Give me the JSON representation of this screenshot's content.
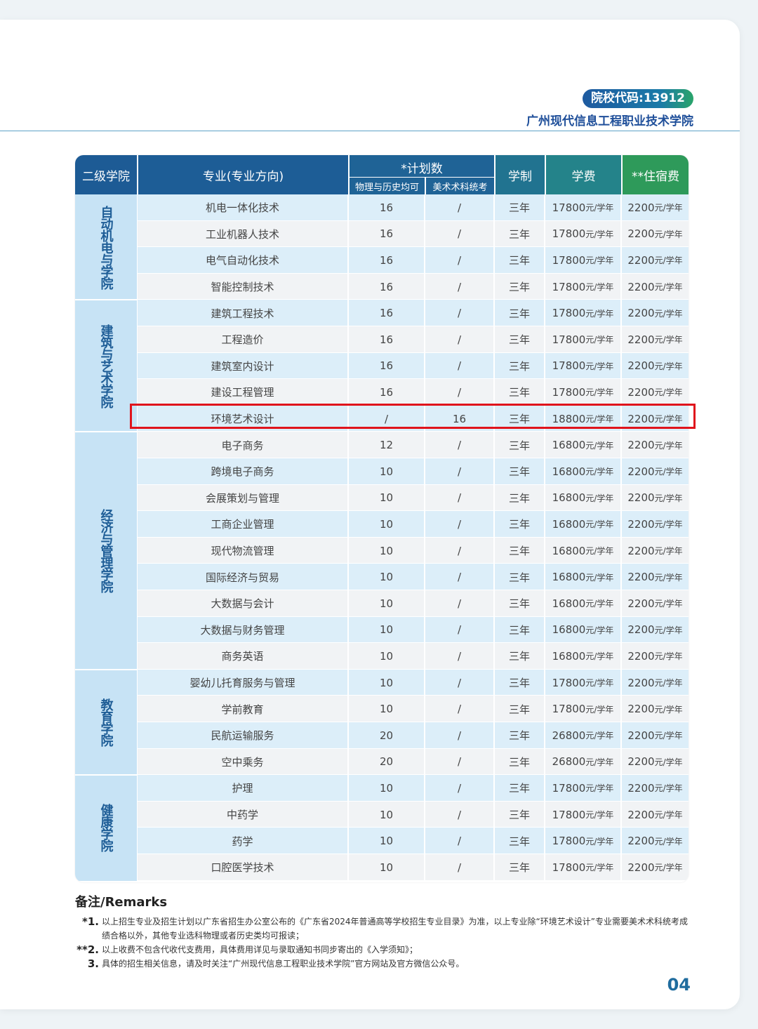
{
  "header": {
    "code": "院校代码:13912",
    "school": "广州现代信息工程职业技术学院"
  },
  "table": {
    "headers": {
      "college": "二级学院",
      "major": "专业(专业方向)",
      "plan": "*计划数",
      "plan_a": "物理与历史均可",
      "plan_b": "美术术科统考",
      "duration": "学制",
      "tuition": "学费",
      "dorm": "**住宿费"
    },
    "colleges": [
      {
        "name": "自动机电与学院",
        "rows": 4
      },
      {
        "name": "建筑与艺术学院",
        "rows": 5
      },
      {
        "name": "经济与管理学院",
        "rows": 9
      },
      {
        "name": "教育学院",
        "rows": 4
      },
      {
        "name": "健康学院",
        "rows": 4
      }
    ],
    "rows": [
      {
        "major": "机电一体化技术",
        "plan_a": "16",
        "plan_b": "/",
        "duration": "三年",
        "tuition": "17800",
        "dorm": "2200"
      },
      {
        "major": "工业机器人技术",
        "plan_a": "16",
        "plan_b": "/",
        "duration": "三年",
        "tuition": "17800",
        "dorm": "2200"
      },
      {
        "major": "电气自动化技术",
        "plan_a": "16",
        "plan_b": "/",
        "duration": "三年",
        "tuition": "17800",
        "dorm": "2200"
      },
      {
        "major": "智能控制技术",
        "plan_a": "16",
        "plan_b": "/",
        "duration": "三年",
        "tuition": "17800",
        "dorm": "2200"
      },
      {
        "major": "建筑工程技术",
        "plan_a": "16",
        "plan_b": "/",
        "duration": "三年",
        "tuition": "17800",
        "dorm": "2200"
      },
      {
        "major": "工程造价",
        "plan_a": "16",
        "plan_b": "/",
        "duration": "三年",
        "tuition": "17800",
        "dorm": "2200"
      },
      {
        "major": "建筑室内设计",
        "plan_a": "16",
        "plan_b": "/",
        "duration": "三年",
        "tuition": "17800",
        "dorm": "2200"
      },
      {
        "major": "建设工程管理",
        "plan_a": "16",
        "plan_b": "/",
        "duration": "三年",
        "tuition": "17800",
        "dorm": "2200"
      },
      {
        "major": "环境艺术设计",
        "plan_a": "/",
        "plan_b": "16",
        "duration": "三年",
        "tuition": "18800",
        "dorm": "2200"
      },
      {
        "major": "电子商务",
        "plan_a": "12",
        "plan_b": "/",
        "duration": "三年",
        "tuition": "16800",
        "dorm": "2200"
      },
      {
        "major": "跨境电子商务",
        "plan_a": "10",
        "plan_b": "/",
        "duration": "三年",
        "tuition": "16800",
        "dorm": "2200"
      },
      {
        "major": "会展策划与管理",
        "plan_a": "10",
        "plan_b": "/",
        "duration": "三年",
        "tuition": "16800",
        "dorm": "2200"
      },
      {
        "major": "工商企业管理",
        "plan_a": "10",
        "plan_b": "/",
        "duration": "三年",
        "tuition": "16800",
        "dorm": "2200"
      },
      {
        "major": "现代物流管理",
        "plan_a": "10",
        "plan_b": "/",
        "duration": "三年",
        "tuition": "16800",
        "dorm": "2200"
      },
      {
        "major": "国际经济与贸易",
        "plan_a": "10",
        "plan_b": "/",
        "duration": "三年",
        "tuition": "16800",
        "dorm": "2200"
      },
      {
        "major": "大数据与会计",
        "plan_a": "10",
        "plan_b": "/",
        "duration": "三年",
        "tuition": "16800",
        "dorm": "2200"
      },
      {
        "major": "大数据与财务管理",
        "plan_a": "10",
        "plan_b": "/",
        "duration": "三年",
        "tuition": "16800",
        "dorm": "2200"
      },
      {
        "major": "商务英语",
        "plan_a": "10",
        "plan_b": "/",
        "duration": "三年",
        "tuition": "16800",
        "dorm": "2200"
      },
      {
        "major": "婴幼儿托育服务与管理",
        "plan_a": "10",
        "plan_b": "/",
        "duration": "三年",
        "tuition": "17800",
        "dorm": "2200"
      },
      {
        "major": "学前教育",
        "plan_a": "10",
        "plan_b": "/",
        "duration": "三年",
        "tuition": "17800",
        "dorm": "2200"
      },
      {
        "major": "民航运输服务",
        "plan_a": "20",
        "plan_b": "/",
        "duration": "三年",
        "tuition": "26800",
        "dorm": "2200"
      },
      {
        "major": "空中乘务",
        "plan_a": "20",
        "plan_b": "/",
        "duration": "三年",
        "tuition": "26800",
        "dorm": "2200"
      },
      {
        "major": "护理",
        "plan_a": "10",
        "plan_b": "/",
        "duration": "三年",
        "tuition": "17800",
        "dorm": "2200"
      },
      {
        "major": "中药学",
        "plan_a": "10",
        "plan_b": "/",
        "duration": "三年",
        "tuition": "17800",
        "dorm": "2200"
      },
      {
        "major": "药学",
        "plan_a": "10",
        "plan_b": "/",
        "duration": "三年",
        "tuition": "17800",
        "dorm": "2200"
      },
      {
        "major": "口腔医学技术",
        "plan_a": "10",
        "plan_b": "/",
        "duration": "三年",
        "tuition": "17800",
        "dorm": "2200"
      }
    ],
    "fee_unit": "元/学年"
  },
  "remarks": {
    "title": "备注/Remarks",
    "notes": [
      {
        "mark": "*1.",
        "text": "以上招生专业及招生计划以广东省招生办公室公布的《广东省2024年普通高等学校招生专业目录》为准，以上专业除“环境艺术设计”专业需要美术术科统考成绩合格以外，其他专业选科物理或者历史类均可报读；"
      },
      {
        "mark": "**2.",
        "text": "以上收费不包含代收代支费用，具体费用详见与录取通知书同步寄出的《入学须知》；"
      },
      {
        "mark": "3.",
        "text": "具体的招生相关信息，请及时关注“广州现代信息工程职业技术学院”官方网站及官方微信公众号。"
      }
    ]
  },
  "page_number": "04",
  "colors": {
    "header_blue": "#1d5b95",
    "header_green": "#2e9a5a",
    "row_blue": "#dceef9",
    "row_gray": "#f1f3f5",
    "college_bg": "#c7e3f5",
    "highlight_red": "#e0141c"
  }
}
